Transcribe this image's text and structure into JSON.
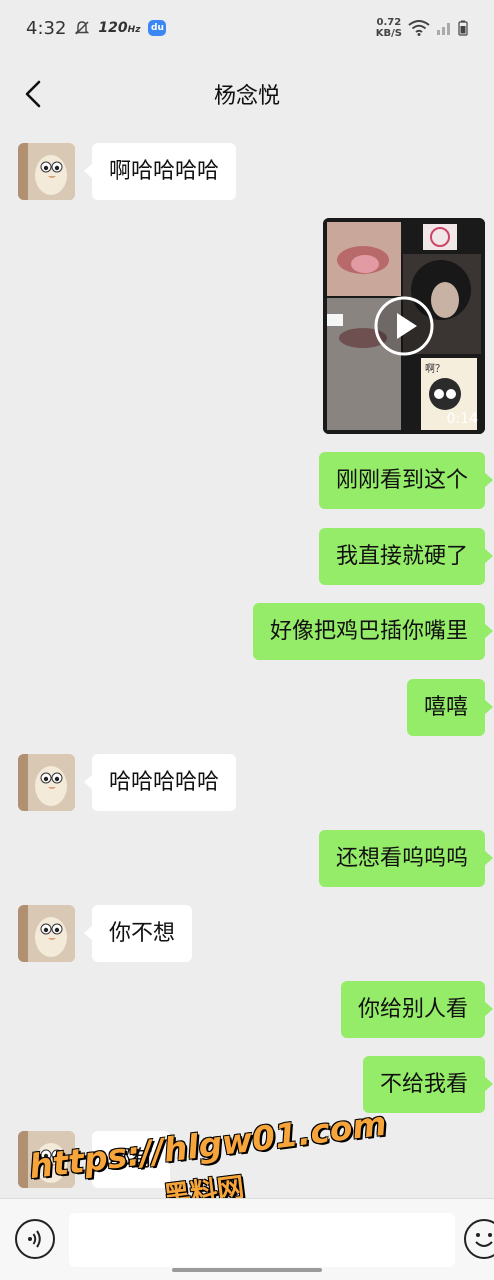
{
  "status_bar": {
    "time": "4:32",
    "refresh_rate": "120",
    "refresh_unit": "Hz",
    "app_badge": "du",
    "net_speed_value": "0.72",
    "net_speed_unit": "KB/S",
    "icons": [
      "mute-icon",
      "wifi-icon",
      "signal-icon",
      "battery-icon"
    ]
  },
  "header": {
    "title": "杨念悦",
    "back_icon": "chevron-left-icon"
  },
  "colors": {
    "background": "#ededed",
    "incoming_bubble": "#ffffff",
    "outgoing_bubble": "#95ec69"
  },
  "messages": [
    {
      "side": "in",
      "text": "啊哈哈哈哈"
    },
    {
      "side": "out",
      "type": "video",
      "duration": "0:14",
      "sticker_text": "啊？"
    },
    {
      "side": "out",
      "text": "刚刚看到这个"
    },
    {
      "side": "out",
      "text": "我直接就硬了"
    },
    {
      "side": "out",
      "text": "好像把鸡巴插你嘴里"
    },
    {
      "side": "out",
      "text": "嘻嘻"
    },
    {
      "side": "in",
      "text": "哈哈哈哈哈"
    },
    {
      "side": "out",
      "text": "还想看呜呜呜"
    },
    {
      "side": "in",
      "text": "你不想"
    },
    {
      "side": "out",
      "text": "你给别人看"
    },
    {
      "side": "out",
      "text": "不给我看"
    },
    {
      "side": "in",
      "text": "哪有"
    }
  ],
  "input_bar": {
    "message_value": "",
    "voice_icon": "voice-icon",
    "emoji_icon": "emoji-icon"
  },
  "watermark": {
    "url": "https://hlgw01.com",
    "site_name": "黑料网"
  }
}
